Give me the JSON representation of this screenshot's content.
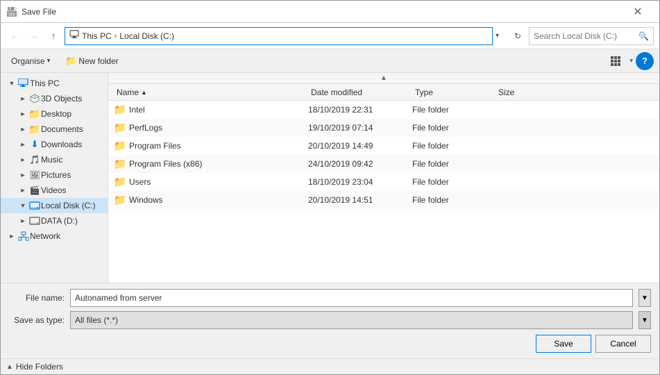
{
  "dialog": {
    "title": "Save File",
    "close_label": "✕"
  },
  "address_bar": {
    "back_tooltip": "Back",
    "forward_tooltip": "Forward",
    "up_tooltip": "Up",
    "path_parts": [
      "This PC",
      "Local Disk (C:)"
    ],
    "path_display": "This PC  ›  Local Disk (C:)",
    "refresh_tooltip": "Refresh",
    "search_placeholder": "Search Local Disk (C:)",
    "search_icon": "🔍"
  },
  "toolbar": {
    "organise_label": "Organise",
    "new_folder_label": "New folder",
    "help_label": "?"
  },
  "sidebar": {
    "items": [
      {
        "id": "this-pc",
        "label": "This PC",
        "icon": "pc",
        "indent": 1,
        "expanded": true,
        "selected": false
      },
      {
        "id": "3d-objects",
        "label": "3D Objects",
        "icon": "3d",
        "indent": 2,
        "expanded": false,
        "selected": false
      },
      {
        "id": "desktop",
        "label": "Desktop",
        "icon": "folder",
        "indent": 2,
        "expanded": false,
        "selected": false
      },
      {
        "id": "documents",
        "label": "Documents",
        "icon": "folder",
        "indent": 2,
        "expanded": false,
        "selected": false
      },
      {
        "id": "downloads",
        "label": "Downloads",
        "icon": "downloads",
        "indent": 2,
        "expanded": false,
        "selected": false
      },
      {
        "id": "music",
        "label": "Music",
        "icon": "music",
        "indent": 2,
        "expanded": false,
        "selected": false
      },
      {
        "id": "pictures",
        "label": "Pictures",
        "icon": "pictures",
        "indent": 2,
        "expanded": false,
        "selected": false
      },
      {
        "id": "videos",
        "label": "Videos",
        "icon": "videos",
        "indent": 2,
        "expanded": false,
        "selected": false
      },
      {
        "id": "local-disk-c",
        "label": "Local Disk (C:)",
        "icon": "disk",
        "indent": 2,
        "expanded": true,
        "selected": true
      },
      {
        "id": "data-d",
        "label": "DATA (D:)",
        "icon": "disk",
        "indent": 2,
        "expanded": false,
        "selected": false
      },
      {
        "id": "network",
        "label": "Network",
        "icon": "network",
        "indent": 1,
        "expanded": false,
        "selected": false
      }
    ]
  },
  "file_list": {
    "columns": [
      {
        "id": "name",
        "label": "Name",
        "sort": "asc"
      },
      {
        "id": "date",
        "label": "Date modified"
      },
      {
        "id": "type",
        "label": "Type"
      },
      {
        "id": "size",
        "label": "Size"
      }
    ],
    "rows": [
      {
        "name": "Intel",
        "date": "18/10/2019 22:31",
        "type": "File folder",
        "size": ""
      },
      {
        "name": "PerfLogs",
        "date": "19/10/2019 07:14",
        "type": "File folder",
        "size": ""
      },
      {
        "name": "Program Files",
        "date": "20/10/2019 14:49",
        "type": "File folder",
        "size": ""
      },
      {
        "name": "Program Files (x86)",
        "date": "24/10/2019 09:42",
        "type": "File folder",
        "size": ""
      },
      {
        "name": "Users",
        "date": "18/10/2019 23:04",
        "type": "File folder",
        "size": ""
      },
      {
        "name": "Windows",
        "date": "20/10/2019 14:51",
        "type": "File folder",
        "size": ""
      }
    ]
  },
  "bottom": {
    "file_name_label": "File name:",
    "file_name_value": "Autonamed from server",
    "save_as_type_label": "Save as type:",
    "save_as_type_value": "All files (*.*)",
    "save_button": "Save",
    "cancel_button": "Cancel",
    "hide_folders_label": "Hide Folders"
  }
}
